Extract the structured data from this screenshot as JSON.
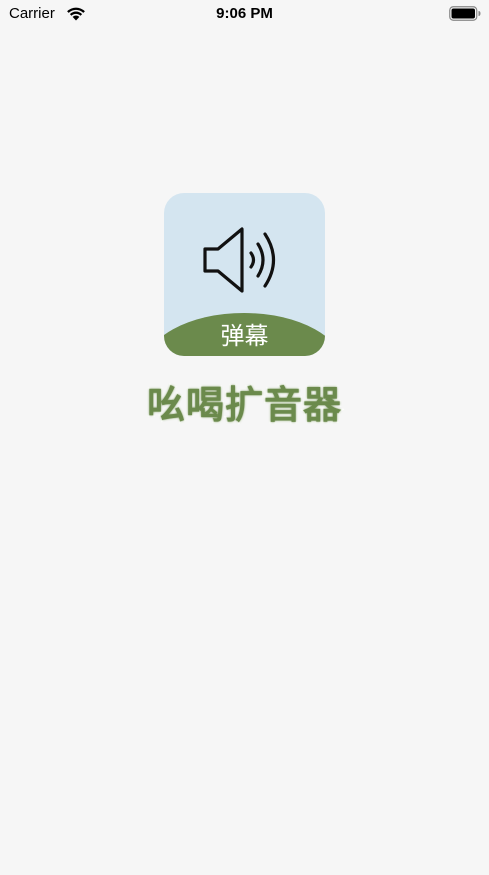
{
  "status_bar": {
    "carrier": "Carrier",
    "time": "9:06 PM",
    "wifi_icon": "wifi-icon",
    "battery_icon": "battery-icon"
  },
  "app_icon": {
    "icon": "speaker-icon",
    "label": "弹幕",
    "background_color": "#d4e5f0",
    "hill_color": "#6b8a4c"
  },
  "app_title": "吆喝扩音器",
  "colors": {
    "background": "#f6f6f6",
    "accent_green": "#6b8a4c"
  }
}
